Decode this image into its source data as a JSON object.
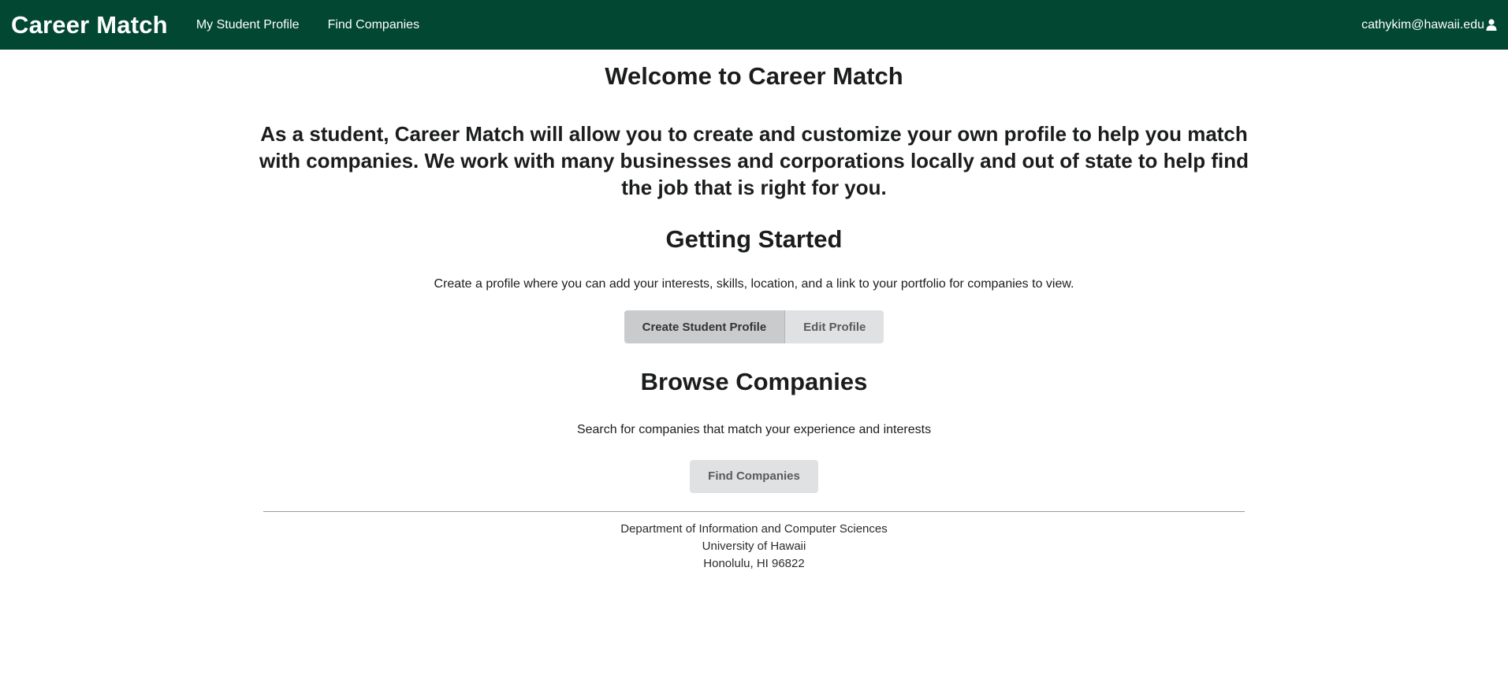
{
  "navbar": {
    "brand": "Career Match",
    "links": [
      "My Student Profile",
      "Find Companies"
    ],
    "user_email": "cathykim@hawaii.edu",
    "user_icon": "user-icon",
    "background": "#024731"
  },
  "main": {
    "welcome_title": "Welcome to Career Match",
    "intro_text": "As a student, Career Match will allow you to create and customize your own profile to help you match with companies. We work with many businesses and corporations locally and out of state to help find the job that is right for you.",
    "getting_started": {
      "title": "Getting Started",
      "description": "Create a profile where you can add your interests, skills, location, and a link to your portfolio for companies to view.",
      "create_button": "Create Student Profile",
      "edit_button": "Edit Profile"
    },
    "browse": {
      "title": "Browse Companies",
      "description": "Search for companies that match your experience and interests",
      "find_button": "Find Companies"
    }
  },
  "footer": {
    "lines": [
      "Department of Information and Computer Sciences",
      "University of Hawaii",
      "Honolulu, HI 96822"
    ]
  }
}
